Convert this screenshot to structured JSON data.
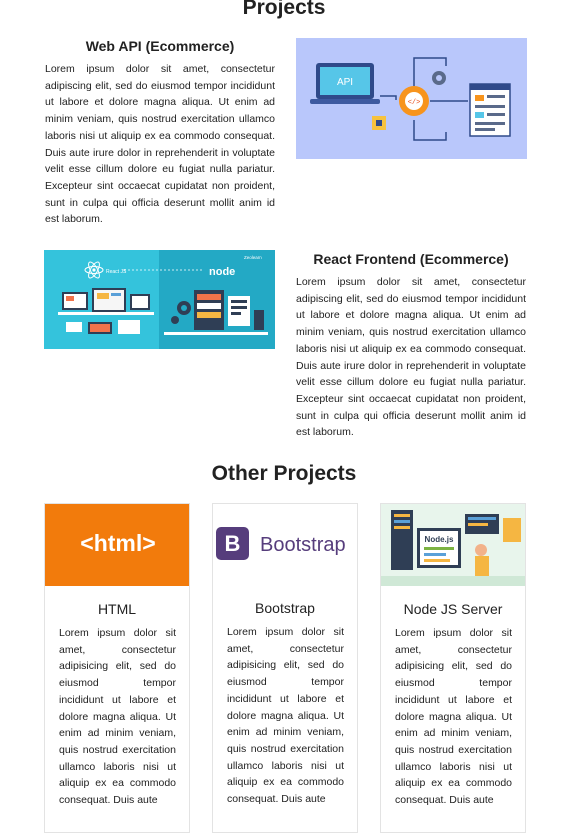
{
  "sections": {
    "projects_title": "Projects",
    "other_title": "Other Projects"
  },
  "projects": [
    {
      "title": "Web API (Ecommerce)",
      "description": "Lorem ipsum dolor sit amet, consectetur adipiscing elit, sed do eiusmod tempor incididunt ut labore et dolore magna aliqua. Ut enim ad minim veniam, quis nostrud exercitation ullamco laboris nisi ut aliquip ex ea commodo consequat. Duis aute irure dolor in reprehenderit in voluptate velit esse cillum dolore eu fugiat nulla pariatur. Excepteur sint occaecat cupidatat non proident, sunt in culpa qui officia deserunt mollit anim id est laborum.",
      "image_text": "API"
    },
    {
      "title": "React Frontend (Ecommerce)",
      "description": "Lorem ipsum dolor sit amet, consectetur adipiscing elit, sed do eiusmod tempor incididunt ut labore et dolore magna aliqua. Ut enim ad minim veniam, quis nostrud exercitation ullamco laboris nisi ut aliquip ex ea commodo consequat. Duis aute irure dolor in reprehenderit in voluptate velit esse cillum dolore eu fugiat nulla pariatur. Excepteur sint occaecat cupidatat non proident, sunt in culpa qui officia deserunt mollit anim id est laborum.",
      "image_react_label": "React JS",
      "image_node_label": "node",
      "image_brand": "Zeolearn"
    }
  ],
  "cards": [
    {
      "title": "HTML",
      "logo_text": "<html>",
      "description": "Lorem ipsum dolor sit amet, consectetur adipisicing elit, sed do eiusmod tempor incididunt ut labore et dolore magna aliqua. Ut enim ad minim veniam, quis nostrud exercitation ullamco laboris nisi ut aliquip ex ea commodo consequat. Duis aute"
    },
    {
      "title": "Bootstrap",
      "logo_letter": "B",
      "logo_text": "Bootstrap",
      "description": "Lorem ipsum dolor sit amet, consectetur adipisicing elit, sed do eiusmod tempor incididunt ut labore et dolore magna aliqua. Ut enim ad minim veniam, quis nostrud exercitation ullamco laboris nisi ut aliquip ex ea commodo consequat. Duis aute"
    },
    {
      "title": "Node JS Server",
      "logo_text": "Node.js",
      "description": "Lorem ipsum dolor sit amet, consectetur adipisicing elit, sed do eiusmod tempor incididunt ut labore et dolore magna aliqua. Ut enim ad minim veniam, quis nostrud exercitation ullamco laboris nisi ut aliquip ex ea commodo consequat. Duis aute"
    }
  ],
  "colors": {
    "html_orange": "#f27b0c",
    "bootstrap_purple": "#563d7c",
    "api_bg": "#b9c7fb",
    "react_node_bg": "#2fc0d9"
  }
}
